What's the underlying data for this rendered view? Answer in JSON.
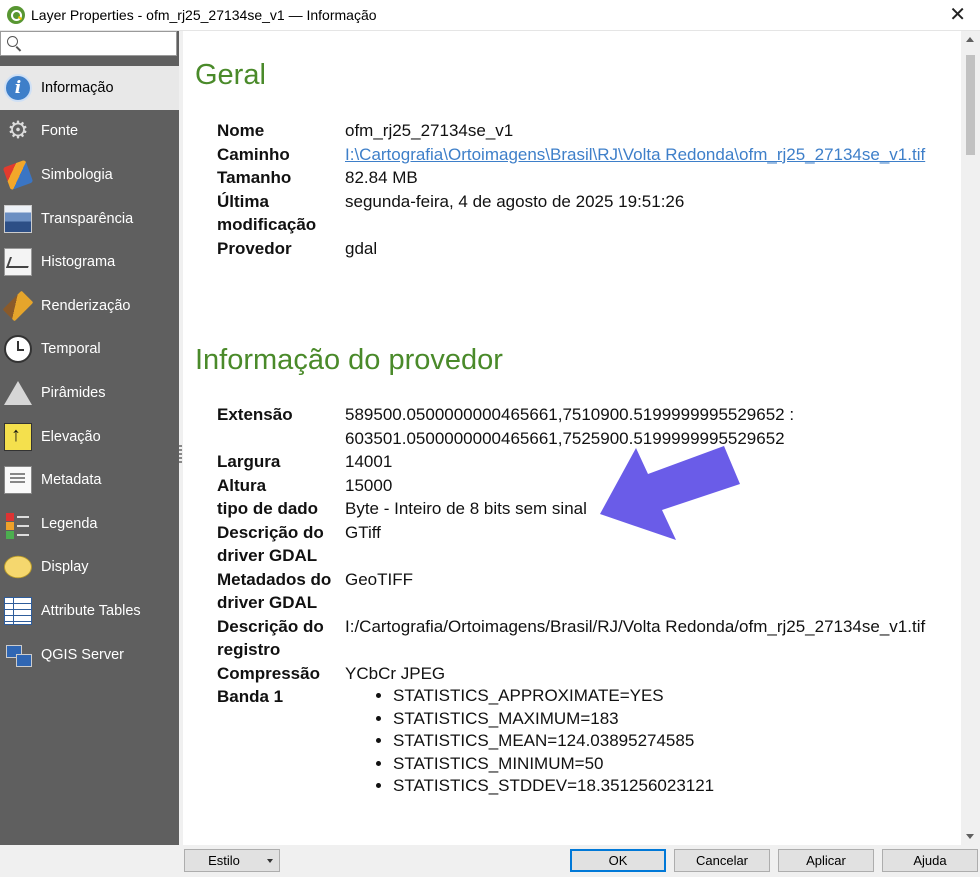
{
  "window": {
    "title": "Layer Properties - ofm_rj25_27134se_v1 — Informação",
    "close_glyph": "✕"
  },
  "sidebar": {
    "search_placeholder": "",
    "items": [
      {
        "label": "Informação",
        "icon": "info-icon",
        "active": true
      },
      {
        "label": "Fonte",
        "icon": "gear-icon"
      },
      {
        "label": "Simbologia",
        "icon": "paint-brush-icon"
      },
      {
        "label": "Transparência",
        "icon": "transparency-icon"
      },
      {
        "label": "Histograma",
        "icon": "histogram-icon"
      },
      {
        "label": "Renderização",
        "icon": "render-brush-icon"
      },
      {
        "label": "Temporal",
        "icon": "clock-icon"
      },
      {
        "label": "Pirâmides",
        "icon": "pyramid-icon"
      },
      {
        "label": "Elevação",
        "icon": "elevation-icon"
      },
      {
        "label": "Metadata",
        "icon": "metadata-icon"
      },
      {
        "label": "Legenda",
        "icon": "legend-icon"
      },
      {
        "label": "Display",
        "icon": "display-icon"
      },
      {
        "label": "Attribute Tables",
        "icon": "attribute-table-icon"
      },
      {
        "label": "QGIS Server",
        "icon": "server-icon"
      }
    ]
  },
  "geral": {
    "title": "Geral",
    "rows": [
      {
        "key": "Nome",
        "value": "ofm_rj25_27134se_v1"
      },
      {
        "key": "Caminho",
        "value": "I:\\Cartografia\\Ortoimagens\\Brasil\\RJ\\Volta Redonda\\ofm_rj25_27134se_v1.tif"
      },
      {
        "key": "Tamanho",
        "value": "82.84 MB"
      },
      {
        "key": "Última modificação",
        "value": "segunda-feira, 4 de agosto de 2025 19:51:26"
      },
      {
        "key": "Provedor",
        "value": "gdal"
      }
    ]
  },
  "provedor": {
    "title": "Informação do provedor",
    "extensao_key": "Extensão",
    "extensao_line1": "589500.0500000000465661,7510900.5199999995529652 :",
    "extensao_line2": "603501.0500000000465661,7525900.5199999995529652",
    "rows": [
      {
        "key": "Largura",
        "value": "14001"
      },
      {
        "key": "Altura",
        "value": "15000"
      },
      {
        "key": "tipo de dado",
        "value": "Byte - Inteiro de 8 bits sem sinal"
      },
      {
        "key": "Descrição do driver GDAL",
        "value": "GTiff"
      },
      {
        "key": "Metadados do driver GDAL",
        "value": "GeoTIFF"
      },
      {
        "key": "Descrição do registro",
        "value": "I:/Cartografia/Ortoimagens/Brasil/RJ/Volta Redonda/ofm_rj25_27134se_v1.tif"
      },
      {
        "key": "Compressão",
        "value": "YCbCr JPEG"
      }
    ],
    "banda_key": "Banda 1",
    "banda_items": [
      "STATISTICS_APPROXIMATE=YES",
      "STATISTICS_MAXIMUM=183",
      "STATISTICS_MEAN=124.03895274585",
      "STATISTICS_MINIMUM=50",
      "STATISTICS_STDDEV=18.351256023121"
    ]
  },
  "footer": {
    "estilo": "Estilo",
    "ok": "OK",
    "cancelar": "Cancelar",
    "aplicar": "Aplicar",
    "ajuda": "Ajuda"
  },
  "colors": {
    "accent_green": "#4a8a2a",
    "sidebar_bg": "#5f5f5f",
    "link_blue": "#3e7fc9",
    "annotation_arrow": "#6a5ce8"
  }
}
